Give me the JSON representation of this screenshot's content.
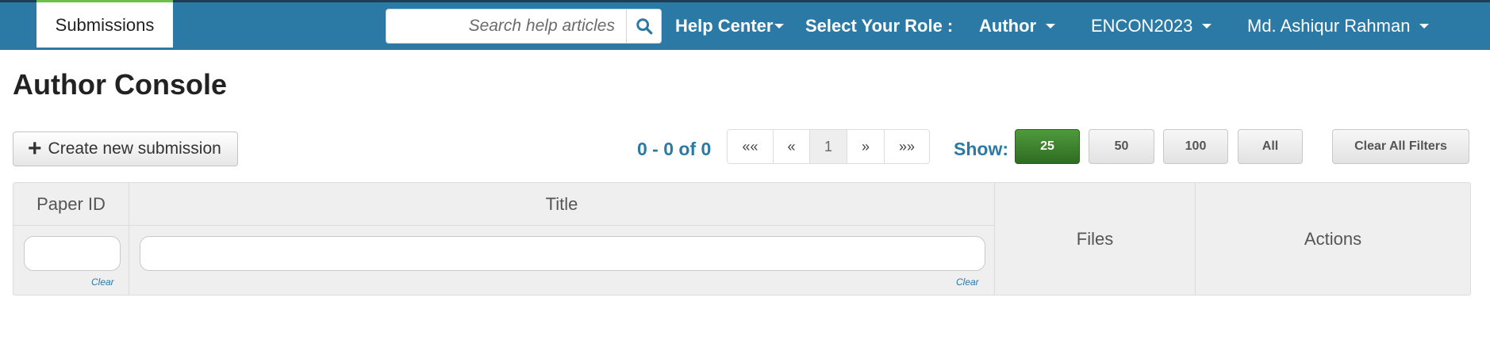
{
  "nav": {
    "submissions_tab": "Submissions",
    "search_placeholder": "Search help articles",
    "help_center": "Help Center",
    "role_label": "Select Your Role :",
    "role_value": "Author",
    "conference": "ENCON2023",
    "user_name": "Md. Ashiqur Rahman"
  },
  "page": {
    "title": "Author Console"
  },
  "toolbar": {
    "create_label": "Create new submission",
    "range_text": "0 - 0 of 0",
    "pager": [
      "««",
      "«",
      "1",
      "»",
      "»»"
    ],
    "active_page": "1",
    "show_label": "Show:",
    "sizes": [
      "25",
      "50",
      "100",
      "All"
    ],
    "active_size": "25",
    "clear_filters_label": "Clear All Filters"
  },
  "table": {
    "headers": {
      "paper_id": "Paper ID",
      "title": "Title",
      "files": "Files",
      "actions": "Actions"
    },
    "filters": {
      "paper_id_value": "",
      "title_value": "",
      "clear_label": "Clear"
    }
  },
  "colors": {
    "navbar": "#2a7aa5",
    "accent_text": "#2a7aa5",
    "active_size_button": "#3a7f2d"
  },
  "icons": {
    "search": "search-icon",
    "plus": "plus-icon",
    "caret": "caret-down-icon"
  }
}
